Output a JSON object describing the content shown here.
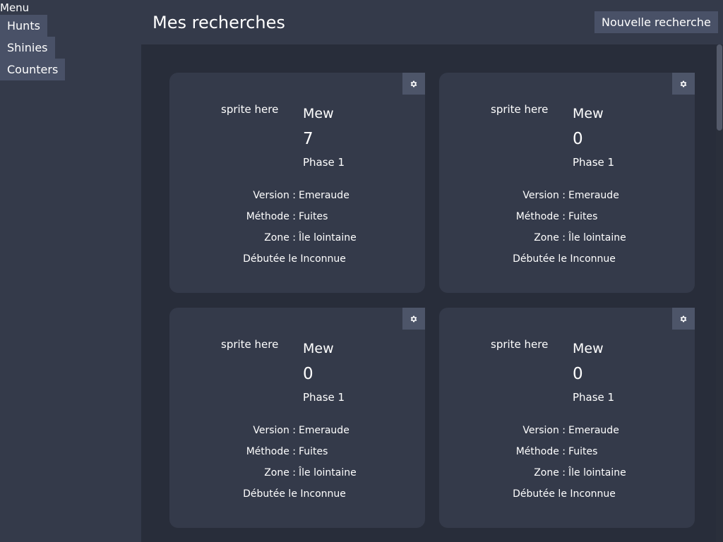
{
  "sidebar": {
    "title": "Menu",
    "items": [
      {
        "label": "Hunts"
      },
      {
        "label": "Shinies"
      },
      {
        "label": "Counters"
      }
    ]
  },
  "header": {
    "title": "Mes recherches",
    "new_button_label": "Nouvelle recherche"
  },
  "colors": {
    "page_bg": "#343a4a",
    "main_bg": "#282d3a",
    "card_bg": "#343a4a",
    "button_bg": "#495167",
    "text": "#ffffff"
  },
  "cards": [
    {
      "sprite_placeholder": "sprite here",
      "name": "Mew",
      "count": "7",
      "phase": "Phase 1",
      "version_label": "Version :",
      "version_value": "Emeraude",
      "method_label": "Méthode :",
      "method_value": "Fuites",
      "zone_label": "Zone :",
      "zone_value": "Île lointaine",
      "started": "Débutée le Inconnue"
    },
    {
      "sprite_placeholder": "sprite here",
      "name": "Mew",
      "count": "0",
      "phase": "Phase 1",
      "version_label": "Version :",
      "version_value": "Emeraude",
      "method_label": "Méthode :",
      "method_value": "Fuites",
      "zone_label": "Zone :",
      "zone_value": "Île lointaine",
      "started": "Débutée le Inconnue"
    },
    {
      "sprite_placeholder": "sprite here",
      "name": "Mew",
      "count": "0",
      "phase": "Phase 1",
      "version_label": "Version :",
      "version_value": "Emeraude",
      "method_label": "Méthode :",
      "method_value": "Fuites",
      "zone_label": "Zone :",
      "zone_value": "Île lointaine",
      "started": "Débutée le Inconnue"
    },
    {
      "sprite_placeholder": "sprite here",
      "name": "Mew",
      "count": "0",
      "phase": "Phase 1",
      "version_label": "Version :",
      "version_value": "Emeraude",
      "method_label": "Méthode :",
      "method_value": "Fuites",
      "zone_label": "Zone :",
      "zone_value": "Île lointaine",
      "started": "Débutée le Inconnue"
    }
  ],
  "icons": {
    "card_settings": "gear-icon"
  }
}
